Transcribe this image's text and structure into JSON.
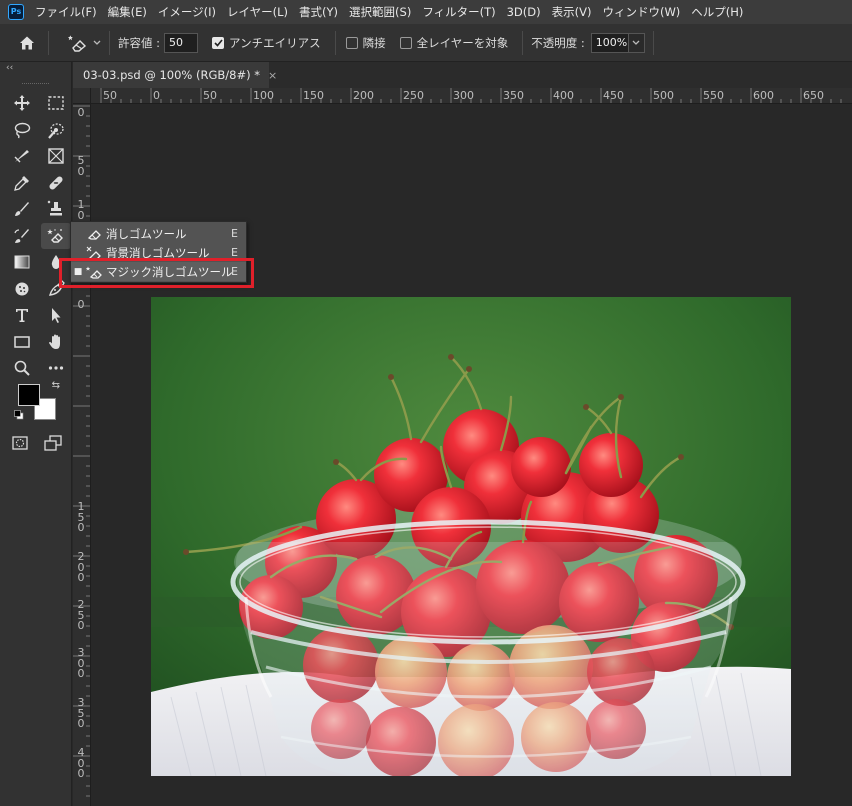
{
  "app": {
    "logo_text": "Ps"
  },
  "menu": [
    "ファイル(F)",
    "編集(E)",
    "イメージ(I)",
    "レイヤー(L)",
    "書式(Y)",
    "選択範囲(S)",
    "フィルター(T)",
    "3D(D)",
    "表示(V)",
    "ウィンドウ(W)",
    "ヘルプ(H)"
  ],
  "options": {
    "tolerance_label": "許容値 :",
    "tolerance_value": "50",
    "antialias_label": "アンチエイリアス",
    "antialias_checked": true,
    "contiguous_label": "隣接",
    "contiguous_checked": false,
    "all_layers_label": "全レイヤーを対象",
    "all_layers_checked": false,
    "opacity_label": "不透明度 :",
    "opacity_value": "100%"
  },
  "panel_collapse": "‹‹",
  "document_tab": {
    "title": "03-03.psd @ 100% (RGB/8#) *",
    "close": "×"
  },
  "ruler_top": [
    "50",
    "0",
    "50",
    "100",
    "150",
    "200",
    "250",
    "300",
    "350",
    "400",
    "450",
    "500",
    "550",
    "600",
    "650"
  ],
  "ruler_left": [
    "0",
    "0",
    "50",
    "10",
    "0",
    "0",
    "150",
    "200",
    "250",
    "300",
    "350",
    "400",
    "450"
  ],
  "flyout": {
    "items": [
      {
        "label": "消しゴムツール",
        "key": "E",
        "icon": "eraser-icon",
        "selected": false
      },
      {
        "label": "背景消しゴムツール",
        "key": "E",
        "icon": "background-eraser-icon",
        "selected": false
      },
      {
        "label": "マジック消しゴムツール",
        "key": "E",
        "icon": "magic-eraser-icon",
        "selected": true
      }
    ],
    "selected_bullet": "■"
  },
  "colors": {
    "foreground": "#000000",
    "background": "#ffffff",
    "highlight": "#e0202a"
  }
}
